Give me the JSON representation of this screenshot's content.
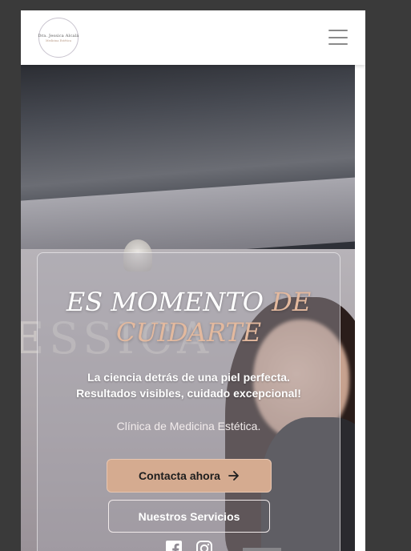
{
  "header": {
    "logo": {
      "name": "Dra. Jessica Alcalá",
      "subtitle": "Medicina Estética"
    },
    "menu_icon": "hamburger-menu-icon"
  },
  "hero": {
    "headline_white": "ES MOMENTO",
    "headline_accent": "DE CUIDARTE",
    "subtitle": "La ciencia detrás de una piel perfecta. Resultados visibles, cuidado excepcional!",
    "tagline": "Clínica de Medicina Estética.",
    "primary_button": {
      "label": "Contacta ahora",
      "icon": "arrow-right-icon"
    },
    "secondary_button": {
      "label": "Nuestros Servicios"
    },
    "socials": [
      "facebook-icon",
      "instagram-icon"
    ]
  },
  "colors": {
    "accent": "#d5ab90",
    "headline_accent": "#e3b99e",
    "background": "#3a3a3a"
  }
}
